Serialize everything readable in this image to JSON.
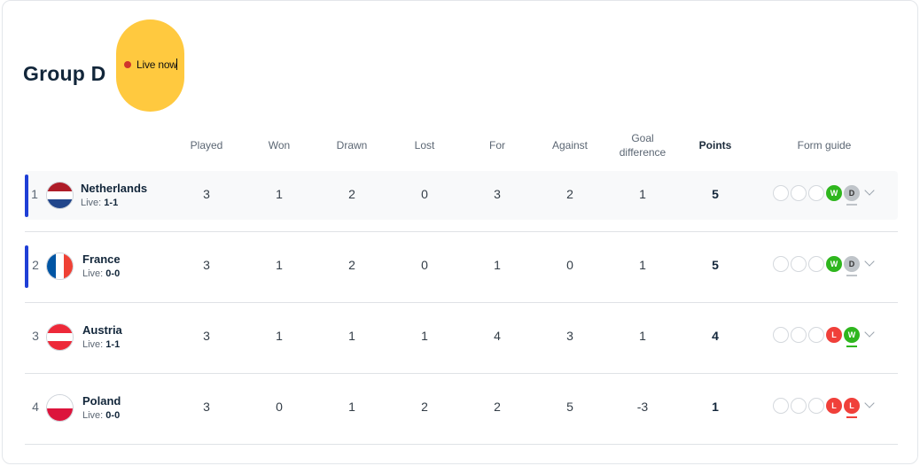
{
  "group": {
    "title": "Group D",
    "live_label": "Live now"
  },
  "columns": {
    "played": "Played",
    "won": "Won",
    "drawn": "Drawn",
    "lost": "Lost",
    "for": "For",
    "against": "Against",
    "goal_difference": "Goal difference",
    "points": "Points",
    "form_guide": "Form guide"
  },
  "colors": {
    "live_bar": "#1f3fd6",
    "win": "#2fb61e",
    "draw": "#bfc4c9",
    "loss": "#f0403a",
    "live_pill": "#ffc93f"
  },
  "teams": [
    {
      "pos": "1",
      "name": "Netherlands",
      "live_prefix": "Live: ",
      "live_score": "1-1",
      "played": "3",
      "won": "1",
      "drawn": "2",
      "lost": "0",
      "for": "3",
      "against": "2",
      "gd": "1",
      "points": "5",
      "flag": [
        "#ae1c28",
        "#ffffff",
        "#21468b"
      ],
      "flag_dir": "h",
      "live": true,
      "form": [
        "",
        "",
        "",
        "W",
        "D"
      ]
    },
    {
      "pos": "2",
      "name": "France",
      "live_prefix": "Live: ",
      "live_score": "0-0",
      "played": "3",
      "won": "1",
      "drawn": "2",
      "lost": "0",
      "for": "1",
      "against": "0",
      "gd": "1",
      "points": "5",
      "flag": [
        "#0055a4",
        "#ffffff",
        "#ef4135"
      ],
      "flag_dir": "v",
      "live": true,
      "form": [
        "",
        "",
        "",
        "W",
        "D"
      ]
    },
    {
      "pos": "3",
      "name": "Austria",
      "live_prefix": "Live: ",
      "live_score": "1-1",
      "played": "3",
      "won": "1",
      "drawn": "1",
      "lost": "1",
      "for": "4",
      "against": "3",
      "gd": "1",
      "points": "4",
      "flag": [
        "#ed2939",
        "#ffffff",
        "#ed2939"
      ],
      "flag_dir": "h",
      "live": false,
      "form": [
        "",
        "",
        "",
        "L",
        "W"
      ]
    },
    {
      "pos": "4",
      "name": "Poland",
      "live_prefix": "Live: ",
      "live_score": "0-0",
      "played": "3",
      "won": "0",
      "drawn": "1",
      "lost": "2",
      "for": "2",
      "against": "5",
      "gd": "-3",
      "points": "1",
      "flag": [
        "#ffffff",
        "#dc143c"
      ],
      "flag_dir": "h",
      "live": false,
      "form": [
        "",
        "",
        "",
        "L",
        "L"
      ]
    }
  ]
}
